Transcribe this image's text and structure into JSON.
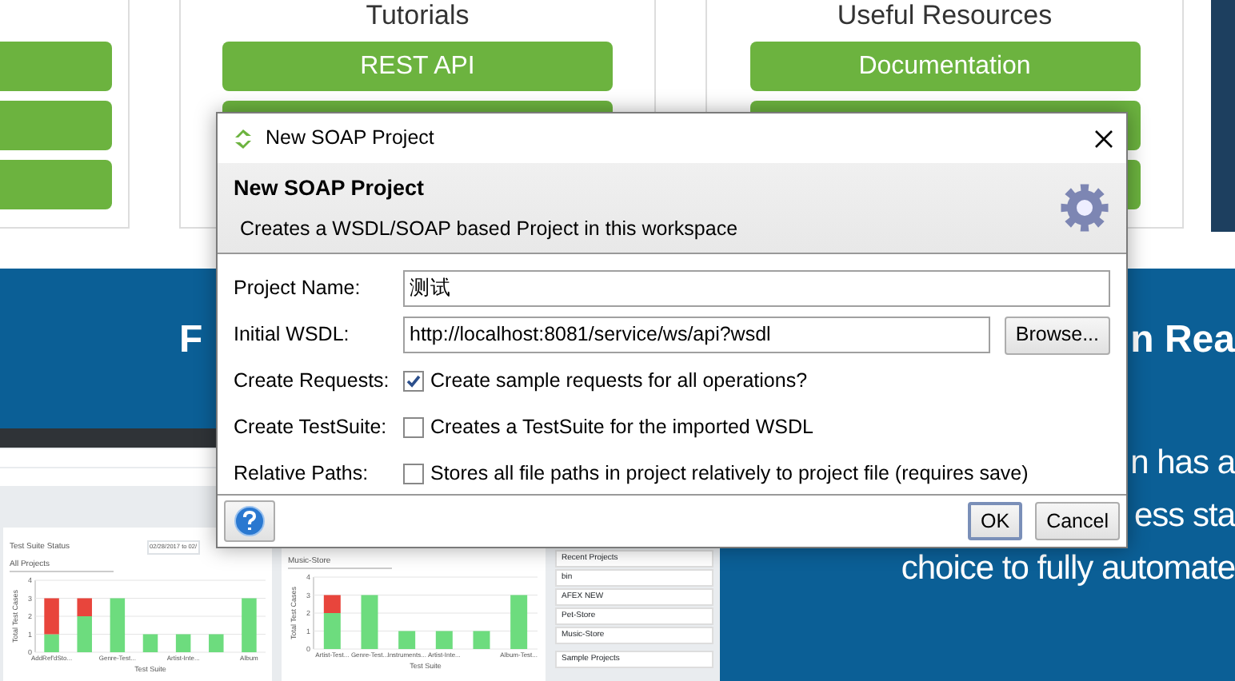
{
  "background_page": {
    "cards": [
      {
        "buttons": [
          {
            "kind": "button"
          },
          {
            "kind": "button"
          },
          {
            "kind": "button"
          }
        ]
      },
      {
        "heading": "Tutorials",
        "buttons": [
          {
            "kind": "button",
            "label": "REST API"
          },
          {
            "kind": "button"
          }
        ]
      },
      {
        "heading": "Useful Resources",
        "buttons": [
          {
            "kind": "button",
            "label": "Documentation"
          },
          {
            "kind": "button"
          },
          {
            "kind": "button"
          }
        ]
      }
    ],
    "banner": {
      "headline_left": "F",
      "headline_right": "n Rea",
      "lines": [
        "n has a",
        "ess sta",
        "choice to fully automate"
      ]
    },
    "dashboard": {
      "chart_panels": [
        {
          "title": "Test Suite Status",
          "date_range": "02/28/2017 to 02/",
          "filter": "All Projects",
          "chart_data": {
            "type": "bar",
            "stacked": true,
            "grid": true,
            "xlabel": "Test Suite",
            "ylabel": "Total Test Cases",
            "categories": [
              "AddRef'dSto...",
              null,
              "Genre-Test...",
              null,
              "Artist-Inte...",
              null,
              "Album"
            ],
            "ylim": [
              0,
              4
            ],
            "yticks": [
              0,
              1,
              2,
              3,
              4
            ],
            "series": [
              {
                "color": "#6ddc7e",
                "values": [
                  1,
                  2,
                  3,
                  1,
                  1,
                  1,
                  3
                ]
              },
              {
                "color": "#e8453c",
                "values": [
                  2,
                  1,
                  0,
                  0,
                  0,
                  0,
                  0
                ]
              }
            ]
          }
        },
        {
          "filter": "Music-Store",
          "chart_data": {
            "type": "bar",
            "stacked": true,
            "grid": true,
            "xlabel": "Test Suite",
            "ylabel": "Total Test Cases",
            "categories": [
              "Artist-Test...",
              "Genre-Test...",
              "Instruments...",
              "Artist-Inte...",
              null,
              "Album-Test..."
            ],
            "ylim": [
              0,
              4
            ],
            "yticks": [
              0,
              1,
              2,
              3,
              4
            ],
            "series": [
              {
                "color": "#6ddc7e",
                "values": [
                  2,
                  3,
                  1,
                  1,
                  1,
                  3
                ]
              },
              {
                "color": "#e8453c",
                "values": [
                  1,
                  0,
                  0,
                  0,
                  0,
                  0
                ]
              }
            ]
          }
        }
      ],
      "recent_projects": {
        "title": "Recent Projects",
        "items": [
          "bin",
          "AFEX NEW",
          "Pet-Store",
          "Music-Store"
        ]
      },
      "sample_projects": {
        "title": "Sample Projects"
      }
    }
  },
  "dialog": {
    "title": "New SOAP Project",
    "header_title": "New SOAP Project",
    "header_text": "Creates a WSDL/SOAP based Project in this workspace",
    "fields": [
      {
        "kind": "text",
        "label": "Project Name:",
        "value": "测试"
      },
      {
        "kind": "text",
        "label": "Initial WSDL:",
        "value": "http://localhost:8081/service/ws/api?wsdl",
        "button": "Browse..."
      },
      {
        "kind": "checkbox",
        "label": "Create Requests:",
        "text": "Create sample requests for all operations?",
        "checked": true
      },
      {
        "kind": "checkbox",
        "label": "Create TestSuite:",
        "text": "Creates a TestSuite for the imported WSDL",
        "checked": false
      },
      {
        "kind": "checkbox",
        "label": "Relative Paths:",
        "text": "Stores all file paths in project relatively to project file (requires save)",
        "checked": false
      }
    ],
    "buttons": [
      {
        "label": "OK",
        "default": true
      },
      {
        "label": "Cancel",
        "default": false
      }
    ]
  }
}
